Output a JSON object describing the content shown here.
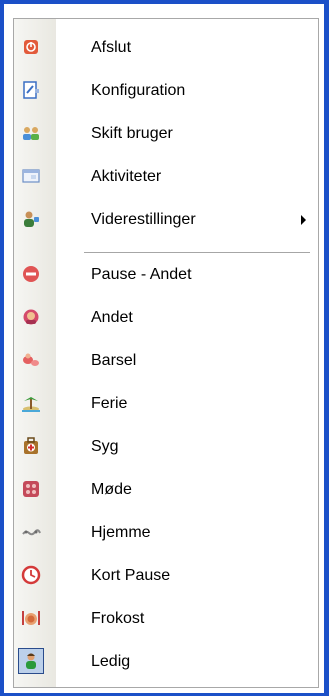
{
  "menu": {
    "items": [
      {
        "label": "Afslut",
        "icon": "exit-icon"
      },
      {
        "label": "Konfiguration",
        "icon": "configuration-icon"
      },
      {
        "label": "Skift bruger",
        "icon": "switch-user-icon"
      },
      {
        "label": "Aktiviteter",
        "icon": "activities-icon"
      },
      {
        "label": "Viderestillinger",
        "icon": "forwarding-icon",
        "submenu": true
      },
      {
        "label": "Pause - Andet",
        "icon": "no-entry-icon"
      },
      {
        "label": "Andet",
        "icon": "person-other-icon"
      },
      {
        "label": "Barsel",
        "icon": "maternity-icon"
      },
      {
        "label": "Ferie",
        "icon": "island-vacation-icon"
      },
      {
        "label": "Syg",
        "icon": "first-aid-icon"
      },
      {
        "label": "Møde",
        "icon": "meeting-icon"
      },
      {
        "label": "Hjemme",
        "icon": "home-icon"
      },
      {
        "label": "Kort Pause",
        "icon": "clock-icon"
      },
      {
        "label": "Frokost",
        "icon": "lunch-icon"
      },
      {
        "label": "Ledig",
        "icon": "available-user-icon",
        "selected": true
      }
    ]
  },
  "colors": {
    "border": "#1b50c8",
    "selection": "#bcd0ea"
  }
}
